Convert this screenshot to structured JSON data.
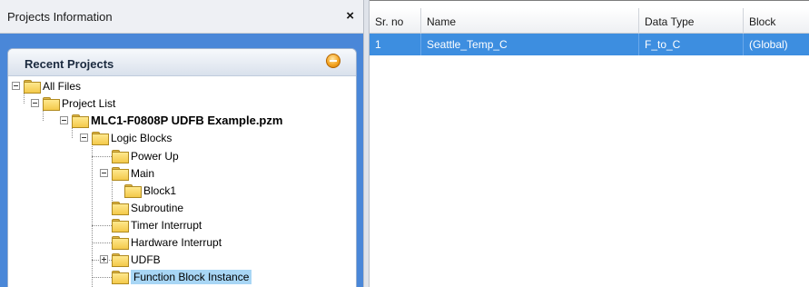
{
  "panel": {
    "title": "Projects Information",
    "close_glyph": "×",
    "close_icon": "close-icon"
  },
  "recent": {
    "title": "Recent Projects",
    "collapse_icon": "collapse-icon"
  },
  "tree": {
    "all_files": "All Files",
    "project_list": "Project List",
    "project": "MLC1-F0808P UDFB Example.pzm",
    "logic_blocks": "Logic Blocks",
    "power_up": "Power Up",
    "main": "Main",
    "block1": "Block1",
    "subroutine": "Subroutine",
    "timer_interrupt": "Timer Interrupt",
    "hardware_interrupt": "Hardware Interrupt",
    "udfb": "UDFB",
    "function_block_instance": "Function Block Instance"
  },
  "grid": {
    "columns": [
      "Sr. no",
      "Name",
      "Data Type",
      "Block"
    ],
    "rows": [
      [
        "1",
        "Seattle_Temp_C",
        "F_to_C",
        "(Global)"
      ]
    ],
    "selected_row_color": "#3d8ee0"
  }
}
